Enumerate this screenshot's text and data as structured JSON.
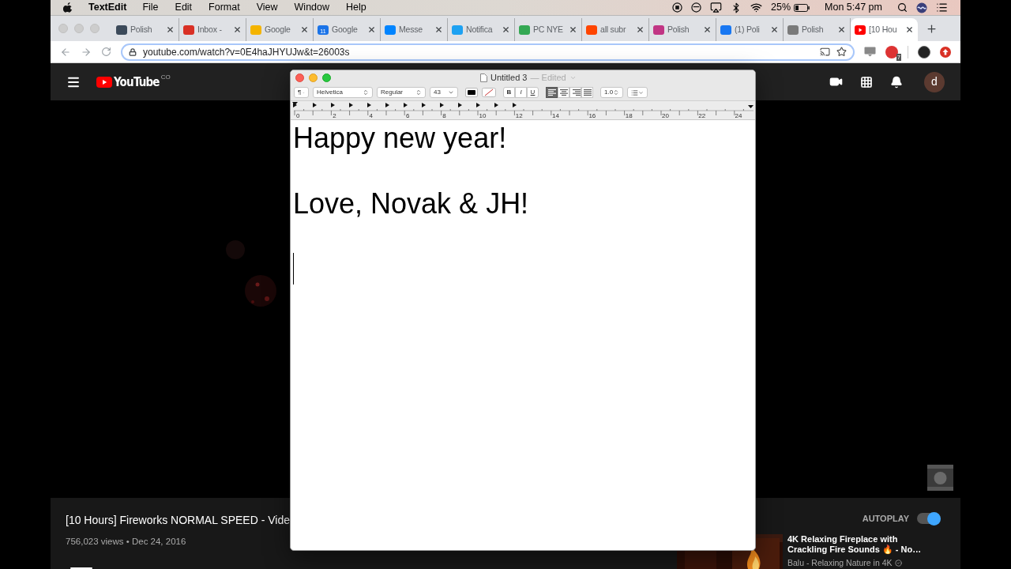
{
  "menu_bar": {
    "app_name": "TextEdit",
    "items": [
      "File",
      "Edit",
      "Format",
      "View",
      "Window",
      "Help"
    ],
    "battery": "25%",
    "clock": "Mon 5:47 pm"
  },
  "browser": {
    "tabs": [
      {
        "title": "Polish",
        "selected": false
      },
      {
        "title": "Inbox -",
        "selected": false
      },
      {
        "title": "Google",
        "selected": false
      },
      {
        "title": "Google",
        "selected": false
      },
      {
        "title": "Messe",
        "selected": false
      },
      {
        "title": "Notifica",
        "selected": false
      },
      {
        "title": "PC NYE",
        "selected": false
      },
      {
        "title": "all subr",
        "selected": false
      },
      {
        "title": "Polish",
        "selected": false
      },
      {
        "title": "(1) Poli",
        "selected": false
      },
      {
        "title": "Polish",
        "selected": false
      },
      {
        "title": "[10 Hou",
        "selected": true
      }
    ],
    "calendar_day": "11",
    "url": "youtube.com/watch?v=0E4haJHYUJw&t=26003s",
    "extension_badge": "7"
  },
  "youtube": {
    "logo": "YouTube",
    "country": "CO",
    "avatar": "d",
    "video": {
      "title": "[10 Hours] Fireworks NORMAL SPEED - Vide",
      "meta": "756,023 views • Dec 24, 2016"
    },
    "autoplay": {
      "label": "AUTOPLAY",
      "on": true
    },
    "up_next": {
      "title": "4K Relaxing Fireplace with Crackling Fire Sounds 🔥 - No…",
      "channel": "Balu - Relaxing Nature in 4K",
      "verified": true
    }
  },
  "textedit": {
    "title": "Untitled 3",
    "status": "— Edited",
    "toolbar": {
      "paragraph": "¶",
      "font": "Helvetica",
      "typeface": "Regular",
      "size": "43",
      "bold": "B",
      "italic": "I",
      "underline": "U",
      "alignment": [
        {
          "kind": "left",
          "selected": true
        },
        {
          "kind": "center",
          "selected": false
        },
        {
          "kind": "right",
          "selected": false
        },
        {
          "kind": "justify",
          "selected": false
        }
      ],
      "spacing": "1.0"
    },
    "ruler": [
      "0",
      "2",
      "4",
      "6",
      "8",
      "10",
      "12",
      "14",
      "16",
      "18",
      "20",
      "22",
      "24"
    ],
    "paragraphs": [
      "Happy new year!",
      "Love, Novak & JH!"
    ]
  }
}
